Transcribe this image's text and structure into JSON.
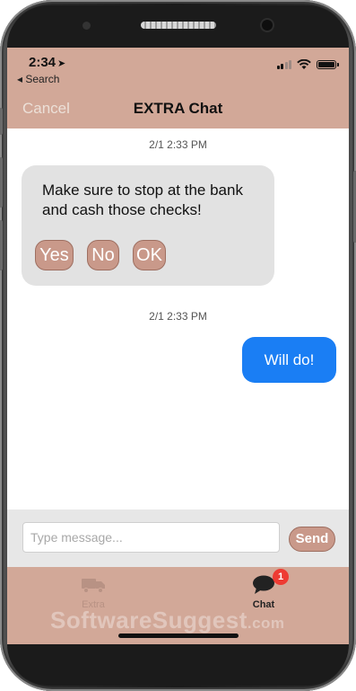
{
  "status_bar": {
    "time": "2:34",
    "back_app": "◂ Search"
  },
  "nav": {
    "cancel_label": "Cancel",
    "title": "EXTRA Chat"
  },
  "messages": [
    {
      "timestamp": "2/1 2:33 PM",
      "direction": "incoming",
      "text": "Make sure to stop at the bank and cash those checks!",
      "quick_replies": [
        "Yes",
        "No",
        "OK"
      ]
    },
    {
      "timestamp": "2/1 2:33 PM",
      "direction": "outgoing",
      "text": "Will do!"
    }
  ],
  "composer": {
    "placeholder": "Type message...",
    "value": "",
    "send_label": "Send"
  },
  "tabs": [
    {
      "label": "Extra",
      "icon": "truck-icon",
      "active": false
    },
    {
      "label": "Chat",
      "icon": "chat-bubble-icon",
      "active": true,
      "badge": "1"
    }
  ],
  "watermark": {
    "brand": "SoftwareSuggest",
    "suffix": ".com"
  },
  "colors": {
    "accent": "#d2a898",
    "button": "#c9998a",
    "outgoing_bubble": "#1a7ef4",
    "incoming_bubble": "#e2e2e2",
    "badge": "#ee3b33"
  }
}
